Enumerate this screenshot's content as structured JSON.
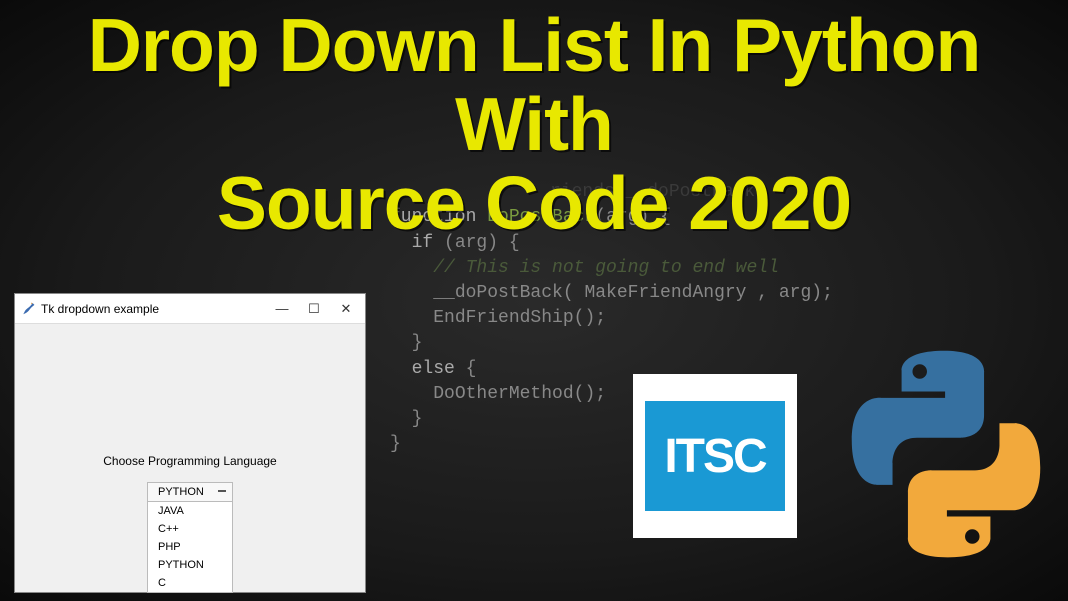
{
  "headline": {
    "line1": "Drop Down List In Python With",
    "line2": "Source Code 2020"
  },
  "code": {
    "ghost1": "riends __doPostBack",
    "l1_kw": "function",
    "l1_fn": "DoPostBack",
    "l1_rest": "(arg) {",
    "l2_kw": "if",
    "l2_rest": " (arg) {",
    "l3_comment": "// This is not going to end well",
    "l4": "__doPostBack( MakeFriendAngry , arg);",
    "l5": "EndFriendShip();",
    "l6": "}",
    "l7_kw": "else",
    "l7_rest": " {",
    "l8": "DoOtherMethod();",
    "l9": "}",
    "l10": "}"
  },
  "app": {
    "title": "Tk dropdown example",
    "min": "—",
    "max": "☐",
    "close": "✕",
    "prompt": "Choose Programming Language",
    "selected": "PYTHON",
    "options": [
      "JAVA",
      "C++",
      "PHP",
      "PYTHON",
      "C"
    ]
  },
  "logos": {
    "itsc": "ITSC",
    "python": "python-logo"
  }
}
